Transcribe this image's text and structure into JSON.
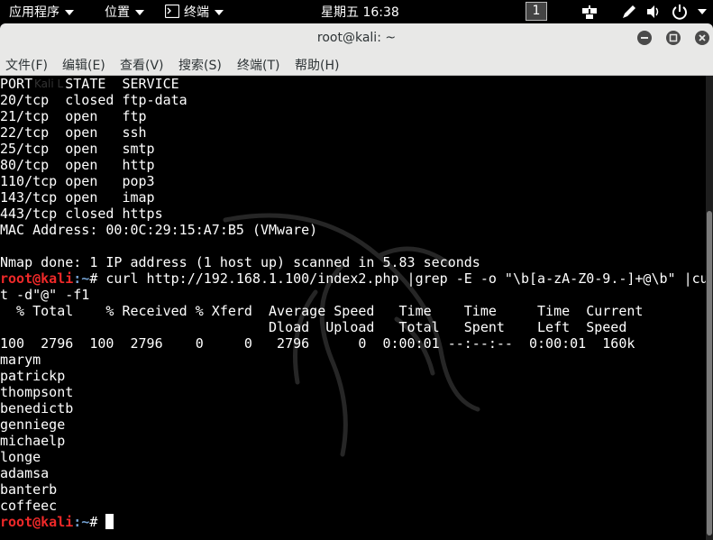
{
  "topbar": {
    "applications": "应用程序",
    "places": "位置",
    "terminal_app": "终端",
    "clock": "星期五 16:38",
    "workspace": "1"
  },
  "window": {
    "title": "root@kali: ~"
  },
  "menu": [
    "文件(F)",
    "编辑(E)",
    "查看(V)",
    "搜索(S)",
    "终端(T)",
    "帮助(H)"
  ],
  "terminal": {
    "watermark_text": "Kali L",
    "lines": [
      {
        "text": "PORT    STATE  SERVICE"
      },
      {
        "text": "20/tcp  closed ftp-data"
      },
      {
        "text": "21/tcp  open   ftp"
      },
      {
        "text": "22/tcp  open   ssh"
      },
      {
        "text": "25/tcp  open   smtp"
      },
      {
        "text": "80/tcp  open   http"
      },
      {
        "text": "110/tcp open   pop3"
      },
      {
        "text": "143/tcp open   imap"
      },
      {
        "text": "443/tcp closed https"
      },
      {
        "text": "MAC Address: 00:0C:29:15:A7:B5 (VMware)"
      },
      {
        "text": ""
      },
      {
        "text": "Nmap done: 1 IP address (1 host up) scanned in 5.83 seconds"
      },
      {
        "prompt": true,
        "user": "root@kali",
        "path": ":~",
        "text": "# curl http://192.168.1.100/index2.php |grep -E -o \"\\b[a-zA-Z0-9.-]+@\\b\" |cu"
      },
      {
        "text": "t -d\"@\" -f1"
      },
      {
        "text": "  % Total    % Received % Xferd  Average Speed   Time    Time     Time  Current"
      },
      {
        "text": "                                 Dload  Upload   Total   Spent    Left  Speed"
      },
      {
        "text": "100  2796  100  2796    0     0   2796      0  0:00:01 --:--:--  0:00:01  160k"
      },
      {
        "text": "marym"
      },
      {
        "text": "patrickp"
      },
      {
        "text": "thompsont"
      },
      {
        "text": "benedictb"
      },
      {
        "text": "genniege"
      },
      {
        "text": "michaelp"
      },
      {
        "text": "longe"
      },
      {
        "text": "adamsa"
      },
      {
        "text": "banterb"
      },
      {
        "text": "coffeec"
      },
      {
        "prompt": true,
        "user": "root@kali",
        "path": ":~",
        "text": "# ",
        "cursor": true
      }
    ]
  },
  "icons": {
    "terminal": "terminal-icon",
    "network": "network-icon",
    "pen": "pen-icon",
    "volume": "volume-icon",
    "power": "power-icon",
    "minimize": "minimize-icon",
    "maximize": "maximize-icon",
    "close": "close-icon"
  }
}
